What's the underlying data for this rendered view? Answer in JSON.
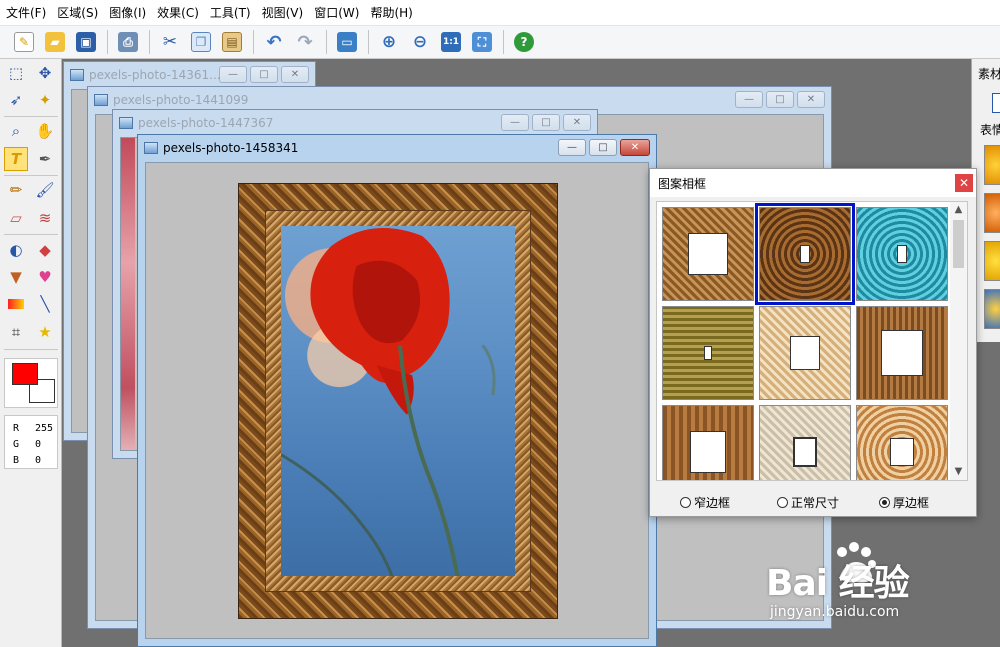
{
  "menu": [
    "文件(F)",
    "区域(S)",
    "图像(I)",
    "效果(C)",
    "工具(T)",
    "视图(V)",
    "窗口(W)",
    "帮助(H)"
  ],
  "toolbar": {
    "icons": [
      "new-icon",
      "open-icon",
      "save-icon",
      "print-icon",
      "cut-icon",
      "copy-icon",
      "paste-icon",
      "undo-icon",
      "redo-icon",
      "screenshot-icon",
      "zoom-in-icon",
      "zoom-out-icon",
      "actual-size-icon",
      "fit-window-icon",
      "help-icon"
    ],
    "actual_size_label": "1:1",
    "help_label": "?"
  },
  "palette": {
    "text_tool_label": "T",
    "color": {
      "r_label": "R",
      "r": "255",
      "g_label": "G",
      "g": "0",
      "b_label": "B",
      "b": "0"
    },
    "foreground": "#ff0000",
    "background": "#ffffff"
  },
  "windows": [
    {
      "title": "pexels-photo-14361...",
      "active": false
    },
    {
      "title": "pexels-photo-1441099",
      "active": false
    },
    {
      "title": "pexels-photo-1447367",
      "active": false
    },
    {
      "title": "pexels-photo-1458341",
      "active": true
    }
  ],
  "window_controls": {
    "minimize": "—",
    "maximize": "□",
    "close": "✕"
  },
  "frame_dialog": {
    "title": "图案相框",
    "close": "✕",
    "frames": [
      {
        "style": "brown-rope",
        "selected": false
      },
      {
        "style": "dark-ornate",
        "selected": true
      },
      {
        "style": "cyan-ornate",
        "selected": false
      },
      {
        "style": "olive-square",
        "selected": false
      },
      {
        "style": "beige-lace",
        "selected": false
      },
      {
        "style": "brown-wood",
        "selected": false
      },
      {
        "style": "wood-plain",
        "selected": false
      },
      {
        "style": "marble-beige",
        "selected": false
      },
      {
        "style": "gold-ornate",
        "selected": false
      }
    ],
    "options": [
      "窄边框",
      "正常尺寸",
      "厚边框"
    ],
    "selected_option": "厚边框"
  },
  "side_panel": {
    "title": "素材",
    "tab": "表情"
  },
  "watermark": {
    "logo": "Bai 经验",
    "url": "jingyan.baidu.com"
  }
}
